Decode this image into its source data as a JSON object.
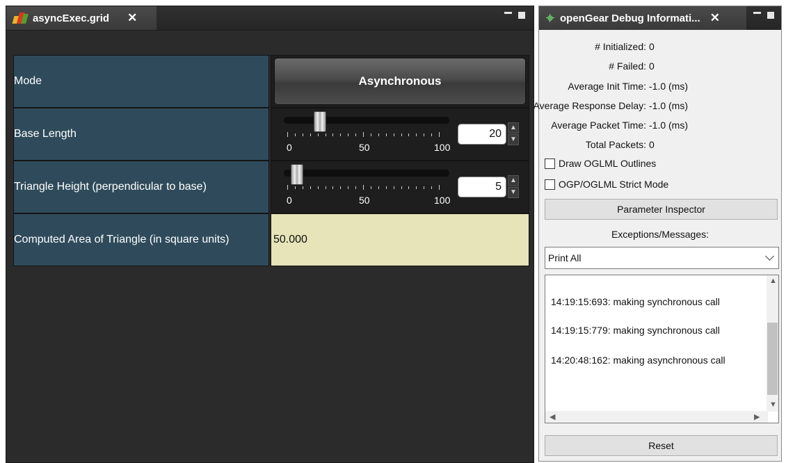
{
  "left_panel": {
    "tab_title": "asyncExec.grid",
    "tab_close": "✕",
    "rows": {
      "mode": {
        "label": "Mode",
        "button": "Asynchronous"
      },
      "base": {
        "label": "Base Length",
        "value": "20",
        "min_label": "0",
        "mid_label": "50",
        "max_label": "100"
      },
      "height": {
        "label": "Triangle Height (perpendicular to base)",
        "value": "5",
        "min_label": "0",
        "mid_label": "50",
        "max_label": "100"
      },
      "area": {
        "label": "Computed Area of Triangle (in square units)",
        "value": "50.000"
      }
    }
  },
  "right_panel": {
    "tab_title": "openGear Debug Informati...",
    "tab_close": "✕",
    "stats": {
      "initialized_label": "# Initialized:",
      "initialized_value": "0",
      "failed_label": "# Failed:",
      "failed_value": "0",
      "avg_init_label": "Average Init Time:",
      "avg_init_value": "-1.0 (ms)",
      "avg_resp_label": "Average Response Delay:",
      "avg_resp_value": "-1.0 (ms)",
      "avg_packet_label": "Average Packet Time:",
      "avg_packet_value": "-1.0 (ms)",
      "total_packets_label": "Total Packets:",
      "total_packets_value": "0"
    },
    "checkboxes": {
      "outlines": "Draw OGLML Outlines",
      "strict": "OGP/OGLML Strict Mode"
    },
    "param_inspector": "Parameter Inspector",
    "exceptions_label": "Exceptions/Messages:",
    "select_value": "Print All",
    "log": [
      "14:19:15:693: making synchronous call",
      "14:19:15:779: making synchronous call",
      "14:20:48:162: making asynchronous call"
    ],
    "reset": "Reset"
  },
  "colors": {
    "label_bg": "#2f4b5b",
    "computed_bg": "#e6e4b8",
    "panel_bg": "#2b2b2b"
  }
}
